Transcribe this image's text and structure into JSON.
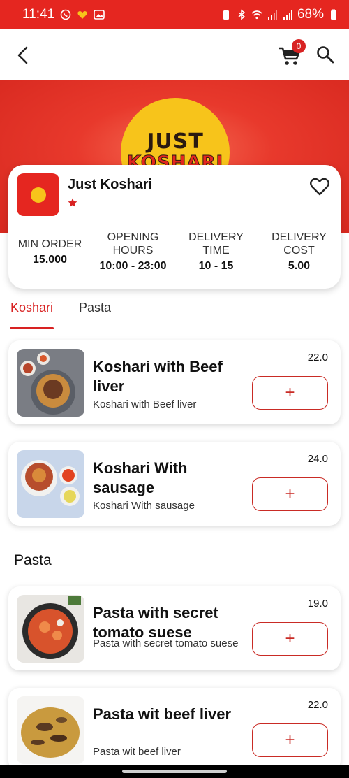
{
  "status_bar": {
    "time": "11:41",
    "battery": "68%"
  },
  "cart": {
    "count": "0"
  },
  "restaurant": {
    "name": "Just Koshari",
    "logo_line1": "JUST",
    "logo_line2": "KOSHARI",
    "stats": [
      {
        "label": "MIN ORDER",
        "value": "15.000"
      },
      {
        "label": "OPENING HOURS",
        "value": "10:00 - 23:00"
      },
      {
        "label": "DELIVERY TIME",
        "value": "10 - 15"
      },
      {
        "label": "DELIVERY COST",
        "value": "5.00"
      }
    ]
  },
  "tabs": [
    {
      "label": "Koshari",
      "active": true
    },
    {
      "label": "Pasta",
      "active": false
    }
  ],
  "sections": {
    "pasta_title": "Pasta"
  },
  "items": [
    {
      "title": "Koshari with Beef liver",
      "desc": "Koshari with Beef liver",
      "price": "22.0",
      "add": "+"
    },
    {
      "title": "Koshari With sausage",
      "desc": "Koshari With sausage",
      "price": "24.0",
      "add": "+"
    },
    {
      "title": "Pasta with secret tomato suese",
      "desc": "Pasta with secret tomato suese",
      "price": "19.0",
      "add": "+"
    },
    {
      "title": "Pasta wit beef liver",
      "desc": "Pasta wit beef liver",
      "price": "22.0",
      "add": "+"
    }
  ],
  "colors": {
    "brand_red": "#e52620",
    "accent": "#d82222",
    "logo_yellow": "#f7c41b"
  }
}
